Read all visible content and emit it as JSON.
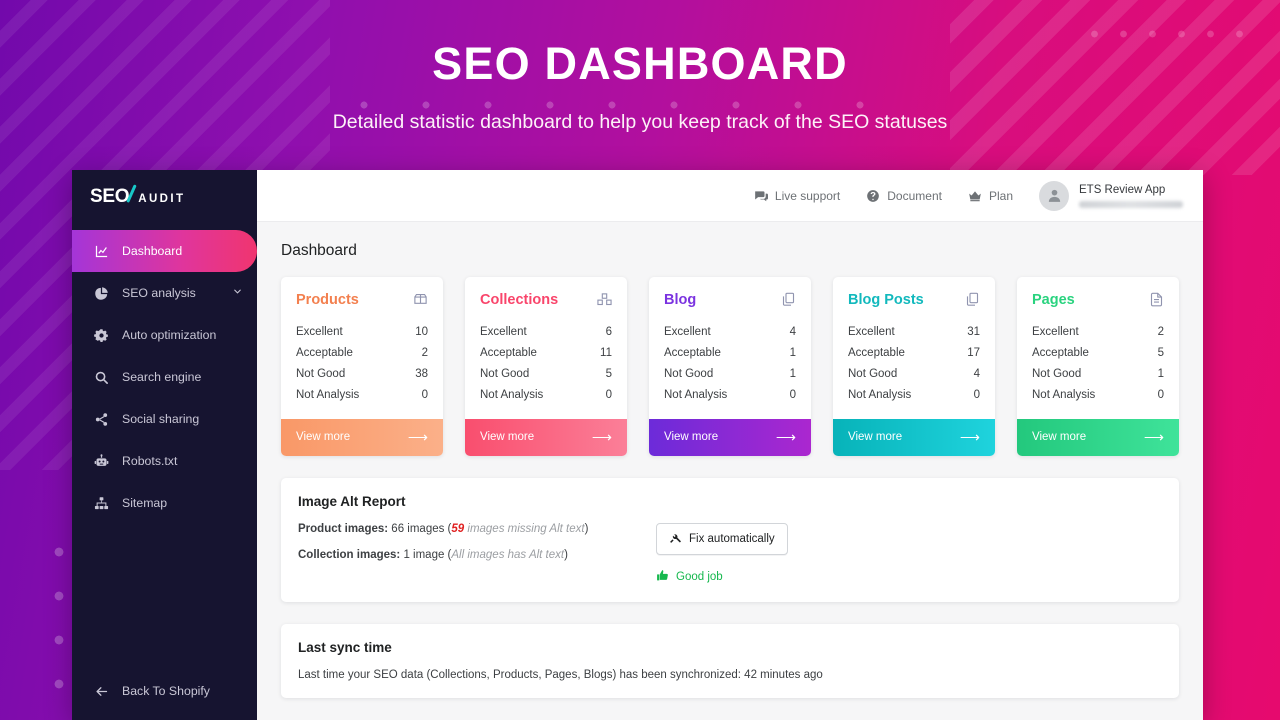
{
  "banner": {
    "title": "SEO DASHBOARD",
    "subtitle": "Detailed statistic dashboard to help you keep track of the SEO statuses"
  },
  "sidebar": {
    "logo": {
      "main": "SEO",
      "sub": "AUDIT"
    },
    "items": [
      {
        "label": "Dashboard",
        "icon": "chart-line-icon",
        "active": true,
        "chevron": ""
      },
      {
        "label": "SEO analysis",
        "icon": "pie-chart-icon",
        "active": false,
        "chevron": "⌄"
      },
      {
        "label": "Auto optimization",
        "icon": "gears-icon",
        "active": false,
        "chevron": ""
      },
      {
        "label": "Search engine",
        "icon": "search-icon",
        "active": false,
        "chevron": ""
      },
      {
        "label": "Social sharing",
        "icon": "share-icon",
        "active": false,
        "chevron": ""
      },
      {
        "label": "Robots.txt",
        "icon": "robot-icon",
        "active": false,
        "chevron": ""
      },
      {
        "label": "Sitemap",
        "icon": "sitemap-icon",
        "active": false,
        "chevron": ""
      }
    ],
    "back": {
      "label": "Back To Shopify",
      "icon": "arrow-left-icon"
    }
  },
  "topbar": {
    "links": [
      {
        "label": "Live support",
        "icon": "chat-icon"
      },
      {
        "label": "Document",
        "icon": "question-circle-icon"
      },
      {
        "label": "Plan",
        "icon": "crown-icon"
      }
    ],
    "user": {
      "name": "ETS Review App",
      "email_redacted": true
    }
  },
  "main": {
    "page_title": "Dashboard",
    "row_labels": [
      "Excellent",
      "Acceptable",
      "Not Good",
      "Not Analysis"
    ],
    "cards": [
      {
        "title": "Products",
        "icon": "box-icon",
        "title_color": "#f3804f",
        "button_gradient": "linear-gradient(90deg,#f99867 0%,#fbb089 100%)",
        "button_label": "View more",
        "arrow": "⟶",
        "values": [
          "10",
          "2",
          "38",
          "0"
        ]
      },
      {
        "title": "Collections",
        "icon": "boxes-icon",
        "title_color": "#f9456b",
        "button_gradient": "linear-gradient(90deg,#f94e6e 0%,#fb7f98 100%)",
        "button_label": "View more",
        "arrow": "⟶",
        "values": [
          "6",
          "11",
          "5",
          "0"
        ]
      },
      {
        "title": "Blog",
        "icon": "copy-icon",
        "title_color": "#7b33e0",
        "button_gradient": "linear-gradient(90deg,#6c2bd9 0%,#ab27cf 100%)",
        "button_label": "View more",
        "arrow": "⟶",
        "values": [
          "4",
          "1",
          "1",
          "0"
        ]
      },
      {
        "title": "Blog Posts",
        "icon": "copy-icon",
        "title_color": "#12b9bd",
        "button_gradient": "linear-gradient(90deg,#07b3b9 0%,#1fd3dd 100%)",
        "button_label": "View more",
        "arrow": "⟶",
        "values": [
          "31",
          "17",
          "4",
          "0"
        ]
      },
      {
        "title": "Pages",
        "icon": "page-icon",
        "title_color": "#2ad37f",
        "button_gradient": "linear-gradient(90deg,#23c87d 0%,#3fe39a 100%)",
        "button_label": "View more",
        "arrow": "⟶",
        "values": [
          "2",
          "5",
          "1",
          "0"
        ]
      }
    ],
    "image_alt_report": {
      "title": "Image Alt Report",
      "product_label": "Product images:",
      "product_value": " 66 images (",
      "product_missing": "59",
      "product_missing_text": " images missing Alt text",
      "product_close": ")",
      "collection_label": "Collection images:",
      "collection_value": " 1 image (",
      "collection_note": "All images has Alt text",
      "collection_close": ")",
      "fix_button": "Fix automatically",
      "fix_icon": "wrench-icon",
      "good_label": "Good job",
      "good_icon": "thumbs-up-icon"
    },
    "last_sync": {
      "title": "Last sync time",
      "text": "Last time your SEO data (Collections, Products, Pages, Blogs) has been synchronized: 42 minutes ago"
    }
  }
}
